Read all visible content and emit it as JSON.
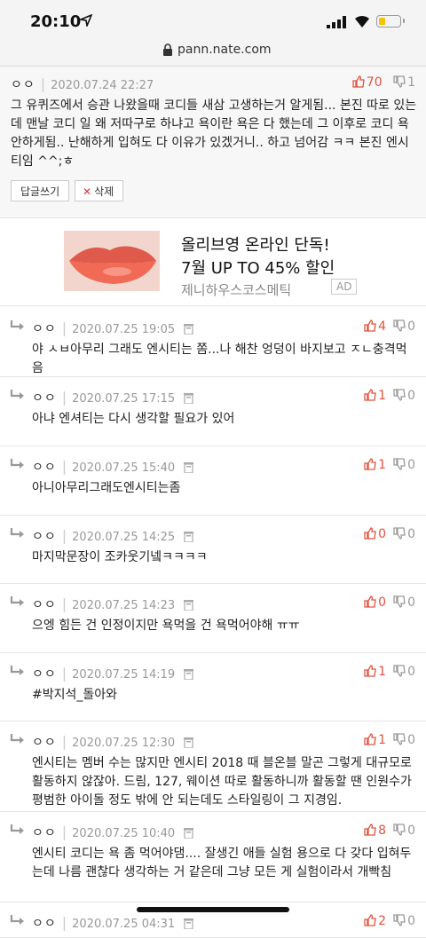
{
  "statusbar": {
    "time": "20:10"
  },
  "urlbar": {
    "url": "pann.nate.com"
  },
  "top_comment": {
    "nick": "ㅇㅇ",
    "date": "2020.07.24 22:27",
    "up": "70",
    "down": "1",
    "text": "그 유퀴즈에서 승관 나왔을때 코디들 새삼 고생하는거 알게됨... 본진 따로 있는데 맨날 코디 일 왜 저따구로 하냐고 욕이란 욕은 다 했는데 그 이후로 코디 욕 안하게됨.. 난해하게 입혀도 다 이유가 있겠거니.. 하고 넘어감 ㅋㅋ 본진 엔시티임 ^^;ㅎ",
    "reply_btn": "답글쓰기",
    "delete_btn": "삭제"
  },
  "ad": {
    "line1": "올리브영 온라인 단독!",
    "line2": "7월 UP TO 45% 할인",
    "brand": "제니하우스코스메틱",
    "badge": "AD"
  },
  "replies": [
    {
      "nick": "ㅇㅇ",
      "date": "2020.07.25 19:05",
      "up": "4",
      "down": "0",
      "text": "야 ㅅㅂ아무리 그래도 엔시티는 쫌...나 해찬 엉덩이 바지보고 ㅈㄴ충격먹음"
    },
    {
      "nick": "ㅇㅇ",
      "date": "2020.07.25 17:15",
      "up": "1",
      "down": "0",
      "text": "아냐 엔셔티는 다시 생각할 필요가 있어"
    },
    {
      "nick": "ㅇㅇ",
      "date": "2020.07.25 15:40",
      "up": "1",
      "down": "0",
      "text": "아니아무리그래도엔시티는좀"
    },
    {
      "nick": "ㅇㅇ",
      "date": "2020.07.25 14:25",
      "up": "0",
      "down": "0",
      "text": "마지막문장이 조카웃기넼ㅋㅋㅋㅋ"
    },
    {
      "nick": "ㅇㅇ",
      "date": "2020.07.25 14:23",
      "up": "0",
      "down": "0",
      "text": "으엥 힘든 건 인정이지만 욕먹을 건 욕먹어야해 ㅠㅠ"
    },
    {
      "nick": "ㅇㅇ",
      "date": "2020.07.25 14:19",
      "up": "1",
      "down": "0",
      "text": "#박지석_돌아와"
    },
    {
      "nick": "ㅇㅇ",
      "date": "2020.07.25 12:30",
      "up": "1",
      "down": "0",
      "text": "엔시티는 멤버 수는 많지만 엔시티 2018 때 블온블 말곤 그렇게 대규모로 활동하지 않잖아. 드림, 127, 웨이션 따로 활동하니까 활동할 땐 인원수가 평범한 아이돌 정도 밖에 안 되는데도 스타일링이 그 지경임."
    },
    {
      "nick": "ㅇㅇ",
      "date": "2020.07.25 10:40",
      "up": "8",
      "down": "0",
      "text": "엔시티 코디는 욕 좀 먹어야댐.... 잘생긴 애들 실험 용으로 다 갖다 입혀두는데 나름 괜찮다 생각하는 거 같은데 그냥 모든 게 실험이라서 개빡침"
    },
    {
      "nick": "ㅇㅇ",
      "date": "2020.07.25 04:31",
      "up": "2",
      "down": "0",
      "text": ""
    }
  ],
  "colors": {
    "accent_up": "#e0533f",
    "down": "#9a9a9a"
  }
}
